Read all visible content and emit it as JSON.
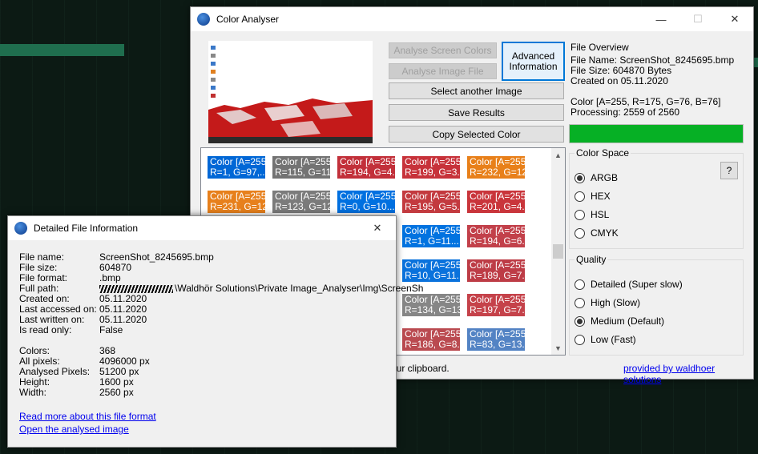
{
  "main_window": {
    "title": "Color Analyser",
    "buttons": {
      "analyse_screen": "Analyse Screen Colors",
      "analyse_image": "Analyse Image File",
      "advanced_info": "Advanced Information",
      "select_image": "Select another Image",
      "save_results": "Save Results",
      "copy_color": "Copy Selected Color"
    },
    "file_overview": {
      "title": "File Overview",
      "file_name": "File Name: ScreenShot_8245695.bmp",
      "file_size": "File Size: 604870 Bytes",
      "created": "Created on 05.11.2020",
      "color": "Color [A=255, R=175, G=76, B=76]",
      "processing": "Processing: 2559 of 2560"
    },
    "progress_fraction": 0.9996,
    "color_space": {
      "title": "Color Space",
      "options": [
        "ARGB",
        "HEX",
        "HSL",
        "CMYK"
      ],
      "selected": "ARGB",
      "help": "?"
    },
    "quality": {
      "title": "Quality",
      "options": [
        "Detailed (Super slow)",
        "High (Slow)",
        "Medium (Default)",
        "Low (Fast)"
      ],
      "selected": "Medium (Default)"
    },
    "status_text": "our clipboard.",
    "footer_link": "provided by waldhoer solutions",
    "swatches": [
      {
        "l1": "Color [A=255,",
        "l2": "R=1, G=97,...",
        "color": "#0067d6"
      },
      {
        "l1": "Color [A=255,",
        "l2": "R=115, G=11...",
        "color": "#737373"
      },
      {
        "l1": "Color [A=255,",
        "l2": "R=194, G=4...",
        "color": "#c2303a"
      },
      {
        "l1": "Color [A=255,",
        "l2": "R=199, G=3...",
        "color": "#c7323a"
      },
      {
        "l1": "Color [A=255,",
        "l2": "R=232, G=12...",
        "color": "#e8801a"
      },
      {
        "l1": "Color [A=255,",
        "l2": "R=231, G=12...",
        "color": "#e7801c"
      },
      {
        "l1": "Color [A=255,",
        "l2": "R=123, G=12...",
        "color": "#7b7b7b"
      },
      {
        "l1": "Color [A=255,",
        "l2": "R=0, G=10...",
        "color": "#0070e0"
      },
      {
        "l1": "Color [A=255,",
        "l2": "R=195, G=5...",
        "color": "#c33a3f"
      },
      {
        "l1": "Color [A=255,",
        "l2": "R=201, G=4...",
        "color": "#c9353b"
      },
      {
        "l1": "Color [A=255,",
        "l2": "R=1, G=11...",
        "color": "#0173e0"
      },
      {
        "l1": "Color [A=255,",
        "l2": "R=194, G=6...",
        "color": "#c2404a"
      },
      {
        "l1": "Color [A=255,",
        "l2": "R=10, G=11...",
        "color": "#0a72dc"
      },
      {
        "l1": "Color [A=255,",
        "l2": "R=189, G=7...",
        "color": "#bd3c46"
      },
      {
        "l1": "Color [A=255,",
        "l2": "R=134, G=13...",
        "color": "#868686"
      },
      {
        "l1": "Color [A=255,",
        "l2": "R=197, G=7...",
        "color": "#c5424a"
      },
      {
        "l1": "Color [A=255,",
        "l2": "R=186, G=8...",
        "color": "#ba4a50"
      },
      {
        "l1": "Color [A=255,",
        "l2": "R=83, G=13...",
        "color": "#5383c4"
      }
    ]
  },
  "detail_window": {
    "title": "Detailed File Information",
    "rows": [
      {
        "label": "File name:",
        "value": "ScreenShot_8245695.bmp"
      },
      {
        "label": "File size:",
        "value": "604870"
      },
      {
        "label": "File format:",
        "value": ".bmp"
      },
      {
        "label": "Full path:",
        "value": "\\Waldhör Solutions\\Private Image_Analyser\\Img\\ScreenSh"
      },
      {
        "label": "Created on:",
        "value": "05.11.2020"
      },
      {
        "label": "Last accessed on:",
        "value": "05.11.2020"
      },
      {
        "label": "Last written on:",
        "value": "05.11.2020"
      },
      {
        "label": "Is read only:",
        "value": "False"
      }
    ],
    "stats": [
      {
        "label": "Colors:",
        "value": "368"
      },
      {
        "label": "All pixels:",
        "value": "4096000 px"
      },
      {
        "label": "Analysed Pixels:",
        "value": "51200 px"
      },
      {
        "label": "Height:",
        "value": "1600 px"
      },
      {
        "label": "Width:",
        "value": "2560 px"
      }
    ],
    "link_format": "Read more about this file format",
    "link_image": "Open the analysed image"
  }
}
